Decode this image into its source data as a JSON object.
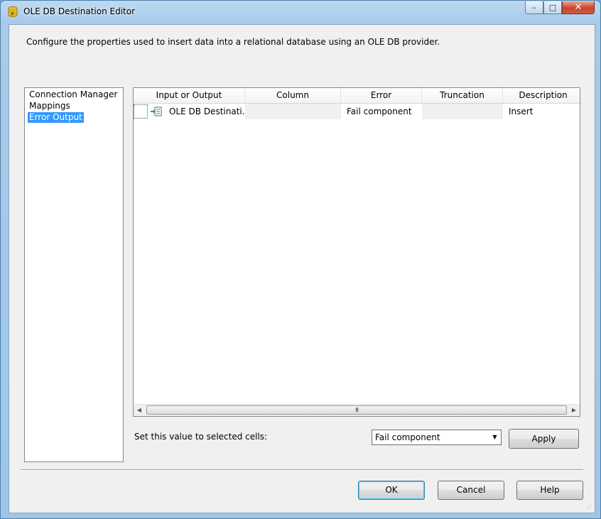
{
  "window": {
    "title": "OLE DB Destination Editor",
    "minimize": "–",
    "maximize": "□",
    "close": "✕"
  },
  "description": "Configure the properties used to insert data into a relational database using an OLE DB provider.",
  "nav": {
    "items": [
      {
        "label": "Connection Manager",
        "selected": false
      },
      {
        "label": "Mappings",
        "selected": false
      },
      {
        "label": "Error Output",
        "selected": true
      }
    ]
  },
  "grid": {
    "columns": [
      "Input or Output",
      "Column",
      "Error",
      "Truncation",
      "Description"
    ],
    "rows": [
      {
        "input_or_output": "OLE DB Destinati...",
        "column": "",
        "error": "Fail component",
        "truncation": "",
        "description": "Insert"
      }
    ],
    "scroll_thumb": "III"
  },
  "set_value": {
    "label": "Set this value to selected cells:",
    "selected": "Fail component",
    "apply_label": "Apply"
  },
  "footer": {
    "ok_label": "OK",
    "cancel_label": "Cancel",
    "help_label": "Help"
  },
  "colors": {
    "selection": "#3399ff",
    "frame": "#a8cbe9",
    "close_button": "#c8452b"
  },
  "icons": {
    "app": "ole-db-destination-icon",
    "row": "input-output-icon"
  }
}
